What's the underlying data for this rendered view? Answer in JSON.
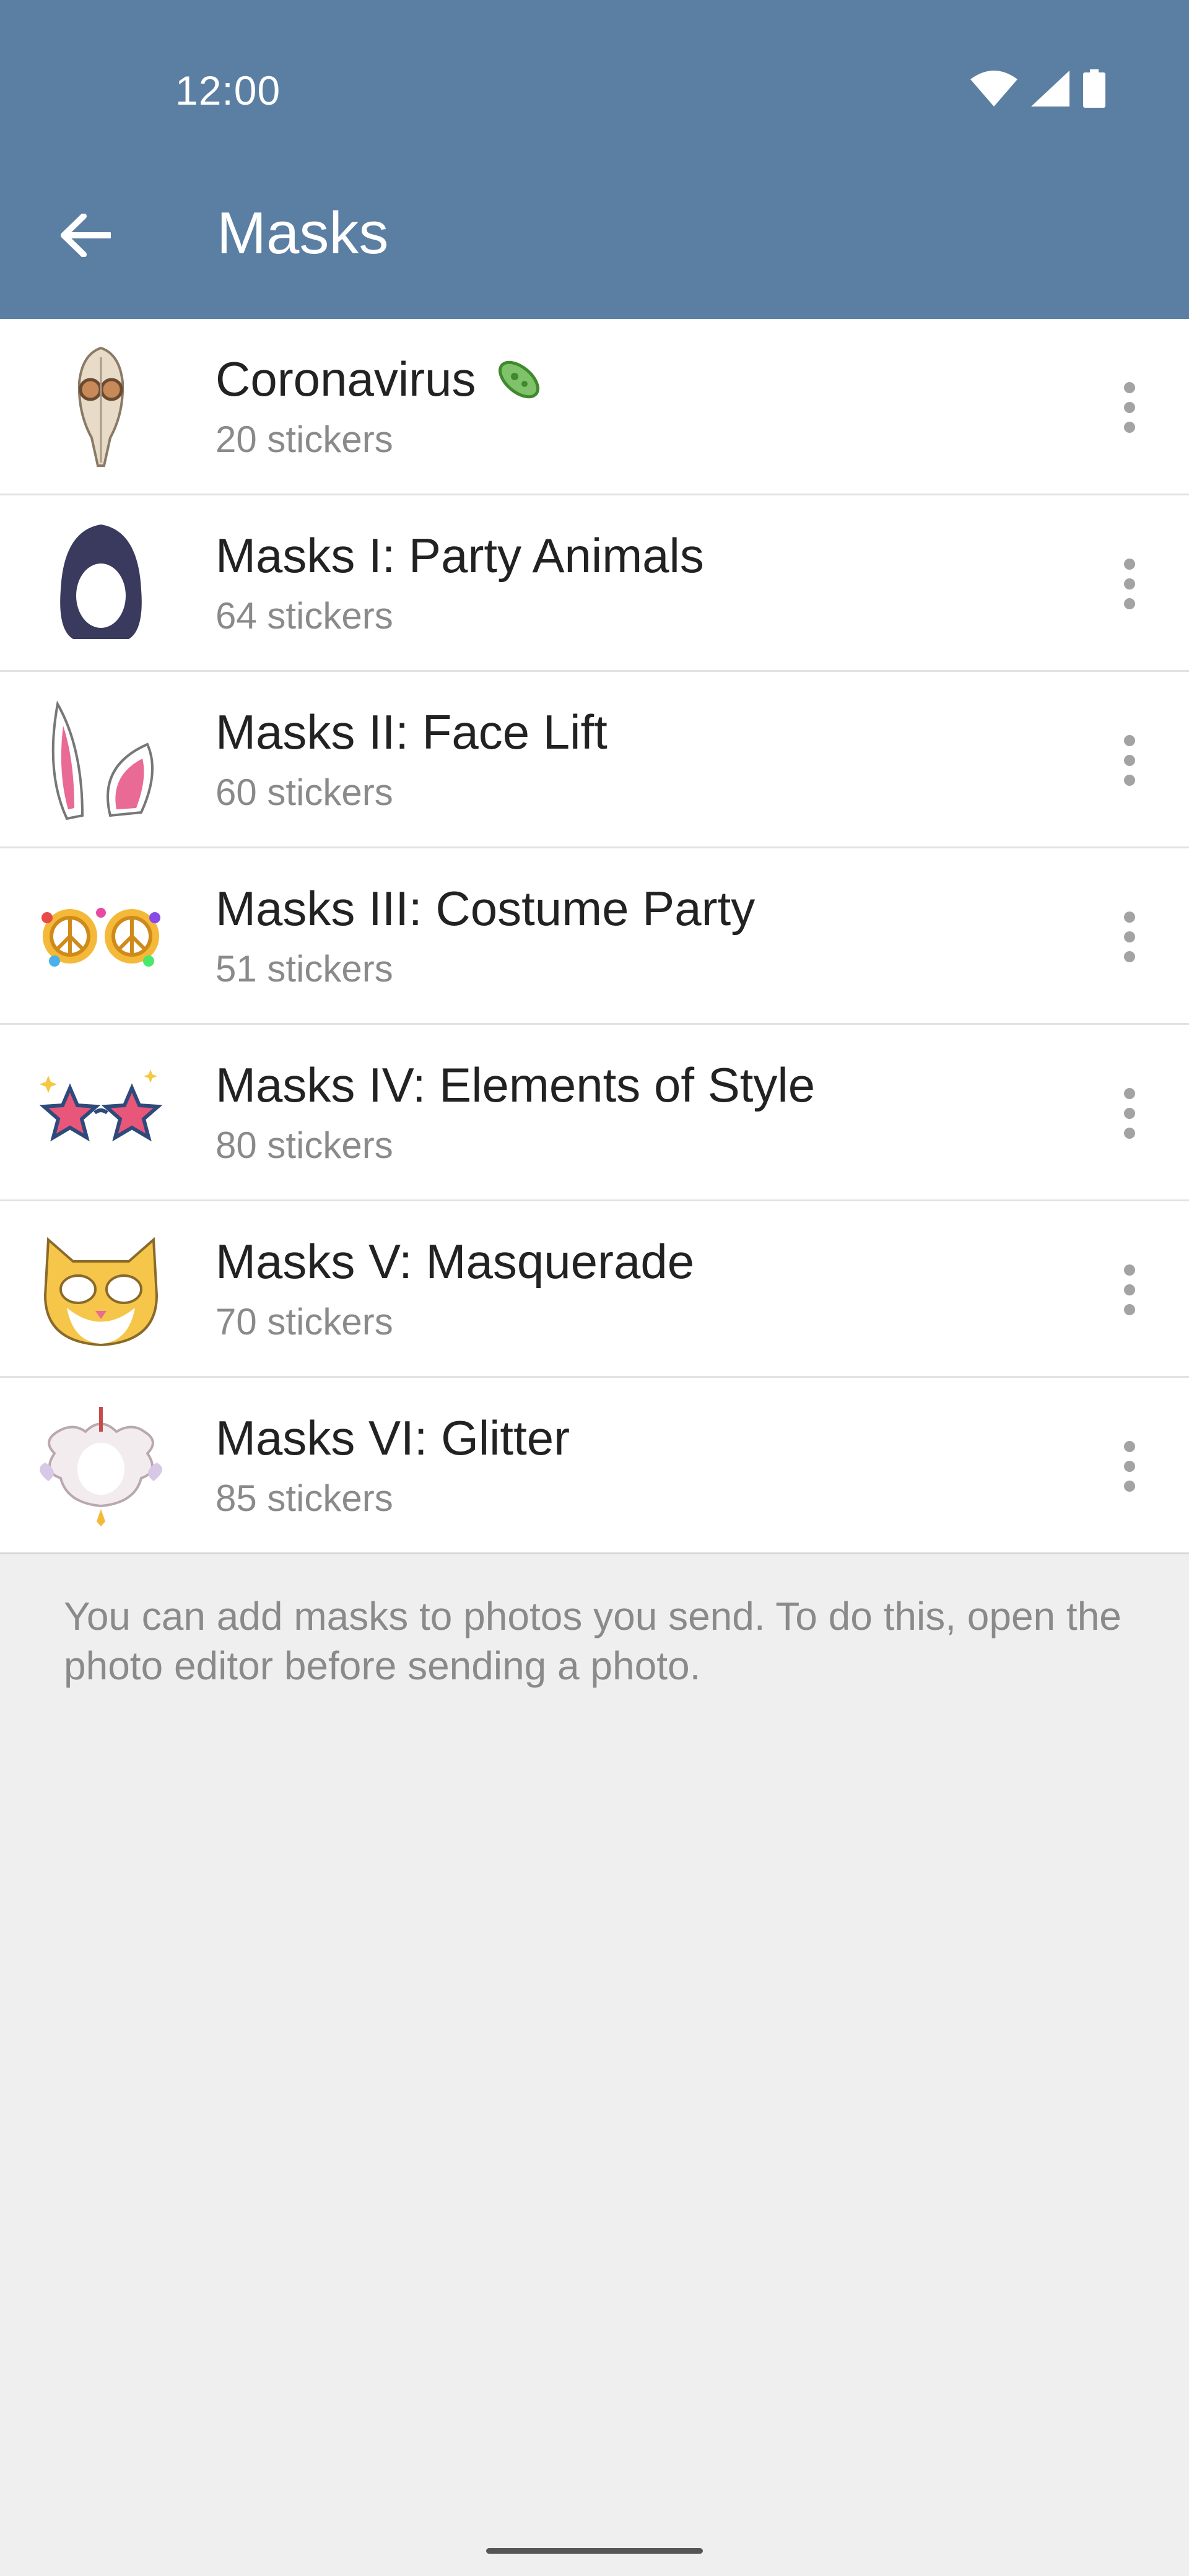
{
  "status_bar": {
    "time": "12:00",
    "icons": [
      "wifi-icon",
      "signal-icon",
      "battery-icon"
    ]
  },
  "header": {
    "title": "Masks",
    "back_icon": "arrow-left-icon",
    "color": "#5b7ea3"
  },
  "sticker_sets": [
    {
      "name": "Coronavirus",
      "count": "20 stickers",
      "emoji_icon": "microbe-icon"
    },
    {
      "name": "Masks I: Party Animals",
      "count": "64 stickers"
    },
    {
      "name": "Masks II: Face Lift",
      "count": "60 stickers"
    },
    {
      "name": "Masks III: Costume Party",
      "count": "51 stickers"
    },
    {
      "name": "Masks IV: Elements of Style",
      "count": "80 stickers"
    },
    {
      "name": "Masks V: Masquerade",
      "count": "70 stickers"
    },
    {
      "name": "Masks VI: Glitter",
      "count": "85 stickers"
    }
  ],
  "info_text": "You can add masks to photos you send. To do this, open the photo editor before sending a photo."
}
